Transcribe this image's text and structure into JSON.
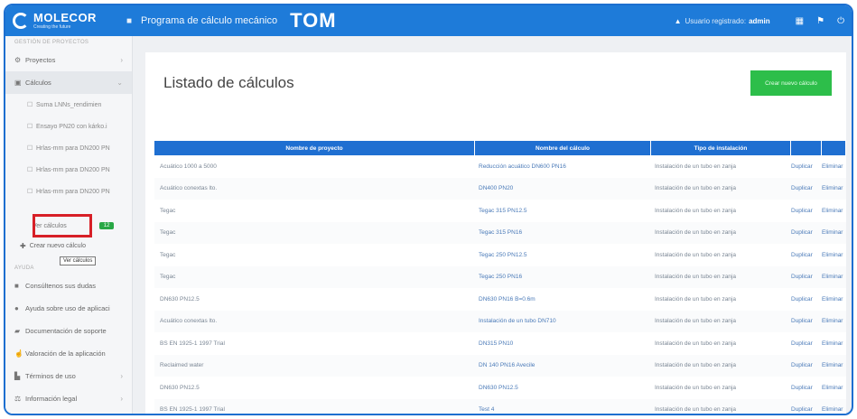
{
  "header": {
    "brand_name": "MOLECOR",
    "brand_tagline": "Creating the future",
    "menu_icon": "menu-icon",
    "app_title": "Programa de cálculo mecánico",
    "app_logo": "TOM",
    "user_label": "Usuario registrado:",
    "user_name": "admin",
    "icons": [
      "grid-icon",
      "flag-icon",
      "power-icon"
    ]
  },
  "sidebar": {
    "section_projects": "Gestión de proyectos",
    "projects_label": "Proyectos",
    "calcs_label": "Cálculos",
    "calc_items": [
      "Suma LNNs_rendimien",
      "Ensayo PN20 con kárko.i",
      "Hrlas-mm para DN200 PN",
      "Hrlas-mm para DN200 PN",
      "Hrlas-mm para DN200 PN"
    ],
    "view_calcs": "Ver cálculos",
    "view_calcs_badge": "12",
    "tooltip": "Ver cálculos",
    "new_calc": "Crear nuevo cálculo",
    "section_help": "Ayuda",
    "help_items": [
      {
        "label": "Consúltenos sus dudas",
        "icon": "chat-icon"
      },
      {
        "label": "Ayuda sobre uso de aplicaci",
        "icon": "question-icon"
      },
      {
        "label": "Documentación de soporte",
        "icon": "book-icon"
      },
      {
        "label": "Valoración de la aplicación",
        "icon": "thumb-icon"
      },
      {
        "label": "Términos de uso",
        "icon": "document-icon"
      },
      {
        "label": "Información legal",
        "icon": "legal-icon"
      }
    ]
  },
  "main": {
    "title": "Listado de cálculos",
    "create_button": "Crear nuevo cálculo",
    "columns": [
      "Nombre de proyecto",
      "Nombre del cálculo",
      "Tipo de instalación",
      "",
      ""
    ],
    "rows": [
      [
        "Acuático 1000 a 5000",
        "Reducción acuático DN600 PN16",
        "Instalación de un tubo en zanja",
        "Duplicar",
        "Eliminar"
      ],
      [
        "Acuático conextas lto.",
        "DN400 PN20",
        "Instalación de un tubo en zanja",
        "Duplicar",
        "Eliminar"
      ],
      [
        "Tegac",
        "Tegac 315 PN12.5",
        "Instalación de un tubo en zanja",
        "Duplicar",
        "Eliminar"
      ],
      [
        "Tegac",
        "Tegac 315 PN16",
        "Instalación de un tubo en zanja",
        "Duplicar",
        "Eliminar"
      ],
      [
        "Tegac",
        "Tegac 250 PN12.5",
        "Instalación de un tubo en zanja",
        "Duplicar",
        "Eliminar"
      ],
      [
        "Tegac",
        "Tegac 250 PN16",
        "Instalación de un tubo en zanja",
        "Duplicar",
        "Eliminar"
      ],
      [
        "DN630 PN12.5",
        "DN630 PN16 B=0.6m",
        "Instalación de un tubo en zanja",
        "Duplicar",
        "Eliminar"
      ],
      [
        "Acuático conextas lto.",
        "Instalación de un tubo DN710",
        "Instalación de un tubo en zanja",
        "Duplicar",
        "Eliminar"
      ],
      [
        "BS EN 1925-1 1997 Trial",
        "DN315 PN10",
        "Instalación de un tubo en zanja",
        "Duplicar",
        "Eliminar"
      ],
      [
        "Reclaimed water",
        "DN 140 PN16 Avecile",
        "Instalación de un tubo en zanja",
        "Duplicar",
        "Eliminar"
      ],
      [
        "DN630 PN12.5",
        "DN630 PN12.5",
        "Instalación de un tubo en zanja",
        "Duplicar",
        "Eliminar"
      ],
      [
        "BS EN 1925-1 1997 Trial",
        "Test 4",
        "Instalación de un tubo en zanja",
        "Duplicar",
        "Eliminar"
      ]
    ]
  },
  "colors": {
    "header": "#1e7bd9",
    "accent": "#2dbe4a",
    "highlight": "#d71f27",
    "table_header": "#1f6fd1"
  }
}
